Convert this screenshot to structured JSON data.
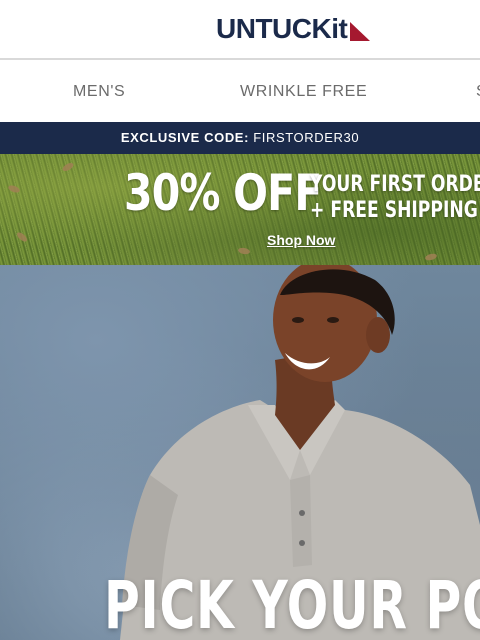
{
  "brand": {
    "logo_text": "UNTUCKit",
    "colors": {
      "navy": "#1b2a4a",
      "red": "#a5192f"
    }
  },
  "nav": {
    "items": [
      {
        "label": "MEN'S"
      },
      {
        "label": "WRINKLE FREE"
      },
      {
        "label": "S"
      }
    ]
  },
  "promo_code": {
    "label": "EXCLUSIVE CODE:",
    "code": "FIRSTORDER30"
  },
  "promo_banner": {
    "headline": "30% OFF",
    "line1": "YOUR FIRST ORDER",
    "line2": "+ FREE SHIPPING",
    "cta": "Shop Now"
  },
  "hero": {
    "headline": "PICK YOUR POLO"
  }
}
